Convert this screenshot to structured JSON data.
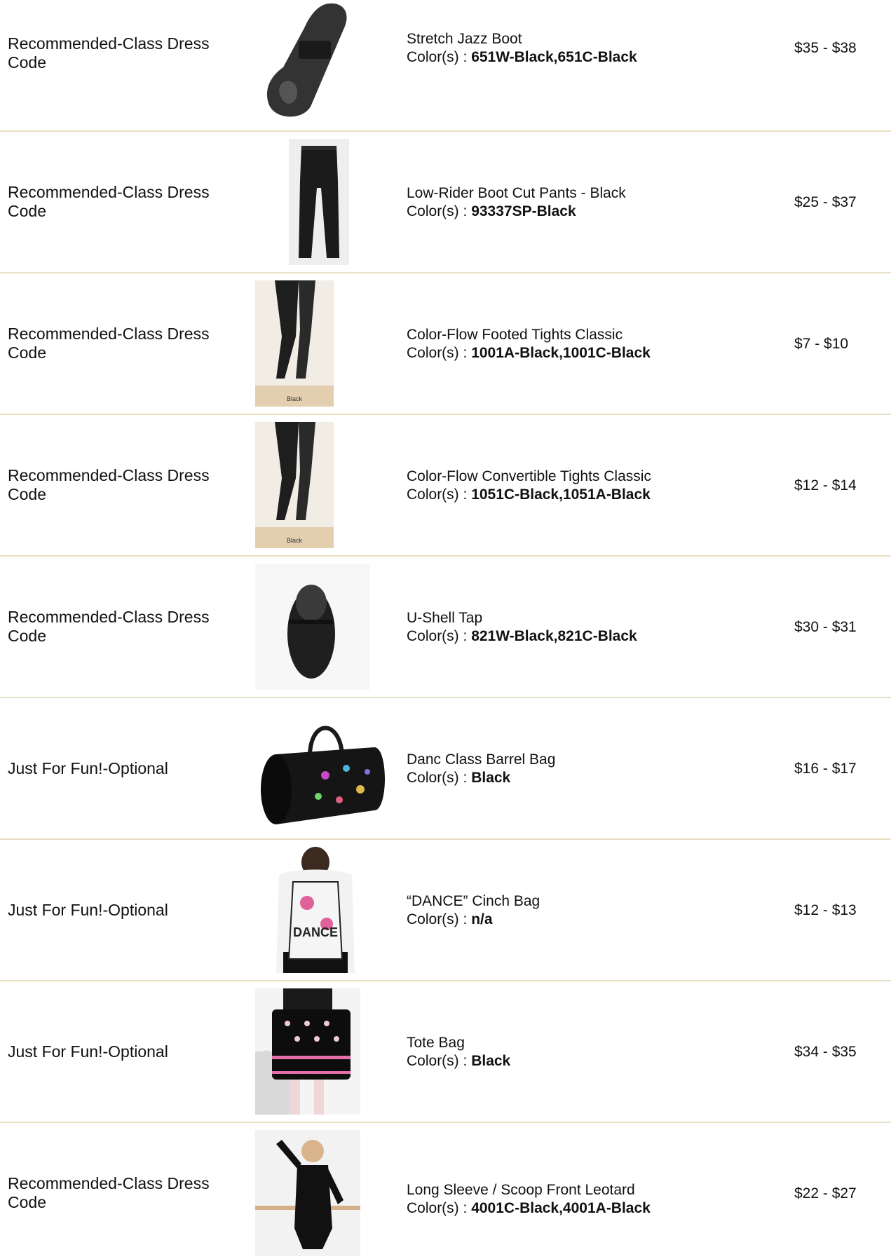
{
  "colors_prefix": "Color(s) : ",
  "items": [
    {
      "category": "Recommended-Class Dress Code",
      "name": "Stretch Jazz Boot",
      "colors": "651W-Black,651C-Black",
      "price": "$35 - $38",
      "image": "jazz-boot-image"
    },
    {
      "category": "Recommended-Class Dress Code",
      "name": "Low-Rider Boot Cut Pants - Black",
      "colors": "93337SP-Black",
      "price": "$25 - $37",
      "image": "boot-cut-pants-image"
    },
    {
      "category": "Recommended-Class Dress Code",
      "name": "Color-Flow Footed Tights Classic",
      "colors": "1001A-Black,1001C-Black",
      "price": "$7 - $10",
      "image": "footed-tights-image",
      "image_caption": "Black"
    },
    {
      "category": "Recommended-Class Dress Code",
      "name": "Color-Flow Convertible Tights Classic",
      "colors": "1051C-Black,1051A-Black",
      "price": "$12 - $14",
      "image": "convertible-tights-image",
      "image_caption": "Black"
    },
    {
      "category": "Recommended-Class Dress Code",
      "name": "U-Shell Tap",
      "colors": "821W-Black,821C-Black",
      "price": "$30 - $31",
      "image": "tap-shoe-image"
    },
    {
      "category": "Just For Fun!-Optional",
      "name": "Danc Class Barrel Bag",
      "colors": "Black",
      "price": "$16 - $17",
      "image": "barrel-bag-image"
    },
    {
      "category": "Just For Fun!-Optional",
      "name": "“DANCE” Cinch Bag",
      "colors": "n/a",
      "price": "$12 - $13",
      "image": "cinch-bag-image",
      "image_caption": "DANCE"
    },
    {
      "category": "Just For Fun!-Optional",
      "name": "Tote Bag",
      "colors": "Black",
      "price": "$34 - $35",
      "image": "tote-bag-image"
    },
    {
      "category": "Recommended-Class Dress Code",
      "name": "Long Sleeve / Scoop Front Leotard",
      "colors": "4001C-Black,4001A-Black",
      "price": "$22 - $27",
      "image": "leotard-image"
    }
  ]
}
